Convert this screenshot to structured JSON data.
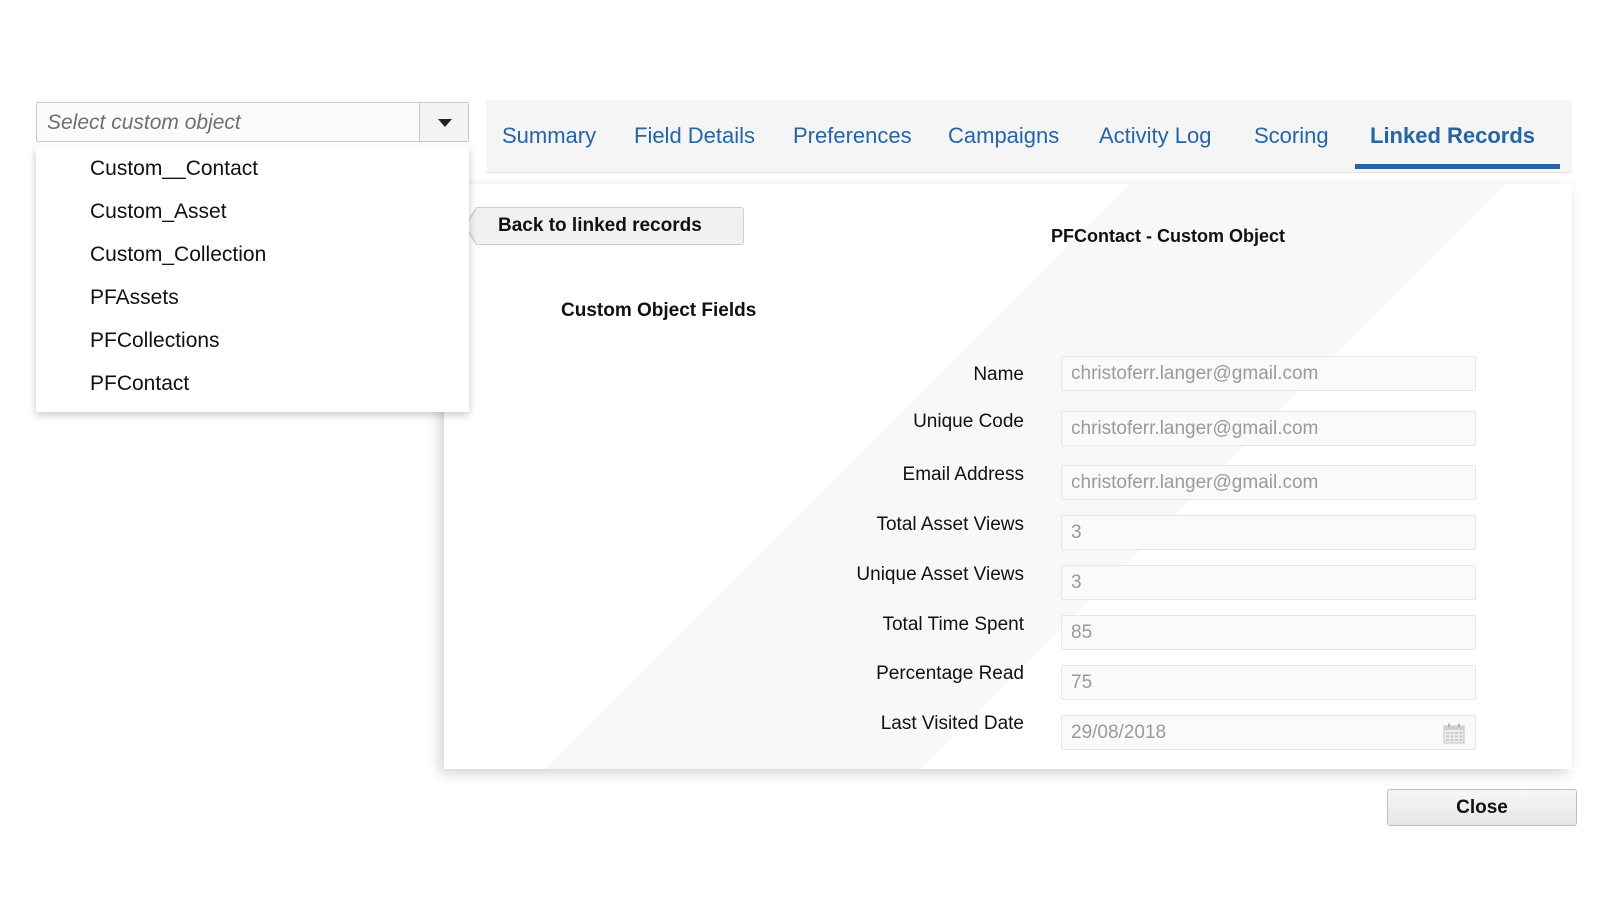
{
  "selector": {
    "placeholder": "Select custom object",
    "options": [
      "Custom__Contact",
      "Custom_Asset",
      "Custom_Collection",
      "PFAssets",
      "PFCollections",
      "PFContact"
    ]
  },
  "tabs": [
    {
      "label": "Summary",
      "active": false
    },
    {
      "label": "Field Details",
      "active": false
    },
    {
      "label": "Preferences",
      "active": false
    },
    {
      "label": "Campaigns",
      "active": false
    },
    {
      "label": "Activity Log",
      "active": false
    },
    {
      "label": "Scoring",
      "active": false
    },
    {
      "label": "Linked Records",
      "active": true
    }
  ],
  "panel": {
    "back_label": "Back to linked records",
    "title": "PFContact - Custom Object",
    "section_title": "Custom Object Fields",
    "fields": [
      {
        "label": "Name",
        "value": "christoferr.langer@gmail.com"
      },
      {
        "label": "Unique Code",
        "value": "christoferr.langer@gmail.com"
      },
      {
        "label": "Email Address",
        "value": "christoferr.langer@gmail.com"
      },
      {
        "label": "Total Asset Views",
        "value": "3"
      },
      {
        "label": "Unique Asset Views",
        "value": "3"
      },
      {
        "label": "Total Time Spent",
        "value": "85"
      },
      {
        "label": "Percentage Read",
        "value": "75"
      },
      {
        "label": "Last Visited Date",
        "value": "29/08/2018",
        "icon": "calendar-icon"
      }
    ]
  },
  "footer": {
    "close_label": "Close"
  },
  "colors": {
    "accent": "#2565a6",
    "field_text": "#9a9a9a"
  }
}
